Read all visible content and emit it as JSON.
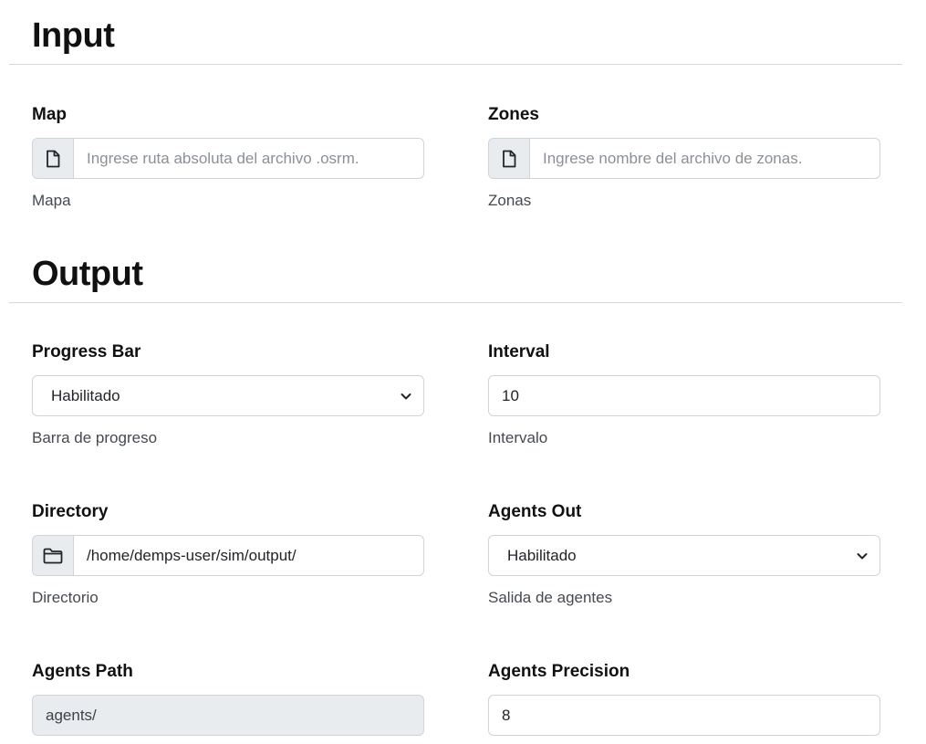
{
  "input_section": {
    "title": "Input",
    "map": {
      "label": "Map",
      "placeholder": "Ingrese ruta absoluta del archivo .osrm.",
      "value": "",
      "help": "Mapa",
      "icon": "file-icon"
    },
    "zones": {
      "label": "Zones",
      "placeholder": "Ingrese nombre del archivo de zonas.",
      "value": "",
      "help": "Zonas",
      "icon": "file-icon"
    }
  },
  "output_section": {
    "title": "Output",
    "progress_bar": {
      "label": "Progress Bar",
      "selected": "Habilitado",
      "help": "Barra de progreso"
    },
    "interval": {
      "label": "Interval",
      "value": "10",
      "help": "Intervalo"
    },
    "directory": {
      "label": "Directory",
      "value": "/home/demps-user/sim/output/",
      "help": "Directorio",
      "icon": "folder-icon"
    },
    "agents_out": {
      "label": "Agents Out",
      "selected": "Habilitado",
      "help": "Salida de agentes"
    },
    "agents_path": {
      "label": "Agents Path",
      "value": "agents/"
    },
    "agents_precision": {
      "label": "Agents Precision",
      "value": "8"
    }
  },
  "colors": {
    "shaded_panel": "#f0f3f8",
    "border": "#cfd4da",
    "addon_bg": "#e9ecef"
  }
}
